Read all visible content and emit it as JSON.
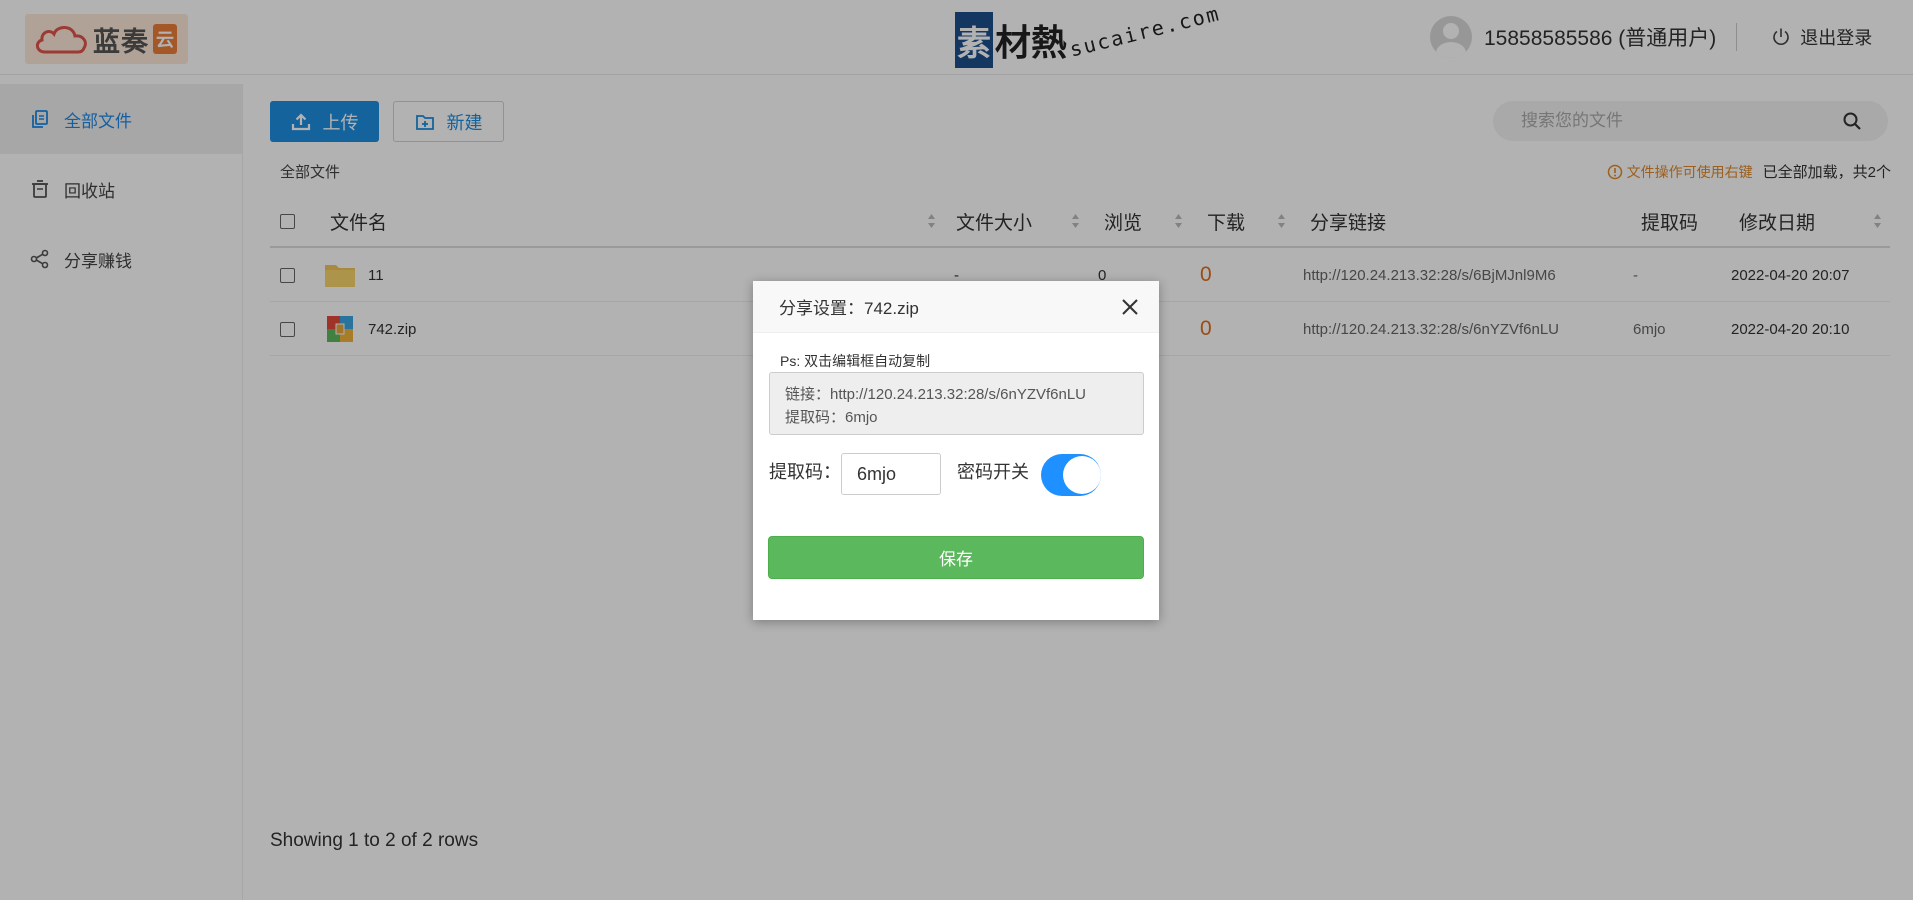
{
  "header": {
    "logo_text": "蓝奏",
    "logo_box": "云",
    "watermark_box": "素",
    "watermark_text": "材熱",
    "watermark_url": "sucaire.com",
    "user_name": "15858585586 (普通用户)",
    "logout_label": "退出登录"
  },
  "sidebar": {
    "items": [
      {
        "label": "全部文件"
      },
      {
        "label": "回收站"
      },
      {
        "label": "分享赚钱"
      }
    ]
  },
  "toolbar": {
    "upload_label": "上传",
    "new_label": "新建",
    "search_placeholder": "搜索您的文件"
  },
  "breadcrumb": "全部文件",
  "hint": {
    "warn": "文件操作可使用右键",
    "count": "已全部加载，共2个"
  },
  "table": {
    "columns": [
      "文件名",
      "文件大小",
      "浏览",
      "下载",
      "分享链接",
      "提取码",
      "修改日期"
    ],
    "rows": [
      {
        "name": "11",
        "size": "-",
        "views": "0",
        "downloads": "0",
        "link": "http://120.24.213.32:28/s/6BjMJnl9M6",
        "code": "-",
        "date": "2022-04-20 20:07"
      },
      {
        "name": "742.zip",
        "size": "",
        "views": "",
        "downloads": "0",
        "link": "http://120.24.213.32:28/s/6nYZVf6nLU",
        "code": "6mjo",
        "date": "2022-04-20 20:10"
      }
    ]
  },
  "footer": "Showing 1 to 2 of 2 rows",
  "modal": {
    "title": "分享设置：742.zip",
    "ps": "Ps: 双击编辑框自动复制",
    "textarea_line1": "链接：http://120.24.213.32:28/s/6nYZVf6nLU",
    "textarea_line2": "提取码：6mjo",
    "code_label": "提取码：",
    "code_value": "6mjo",
    "switch_label": "密码开关",
    "switch_on": true,
    "save_label": "保存"
  },
  "colors": {
    "primary": "#1d8fe0",
    "success": "#5cb85c",
    "warning": "#e0892a",
    "download": "#e06d1a",
    "toggle": "#1e90ff"
  }
}
